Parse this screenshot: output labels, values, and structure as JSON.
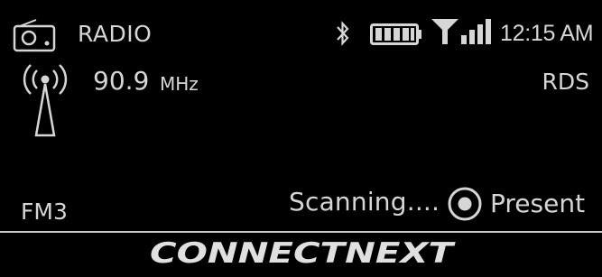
{
  "status_bar": {
    "source": "RADIO",
    "time": "12:15 AM",
    "icons": [
      "radio-icon",
      "bluetooth-icon",
      "battery-icon",
      "signal-icon"
    ]
  },
  "tuner": {
    "frequency": "90.9",
    "unit": "MHz",
    "rds": "RDS",
    "band": "FM3",
    "status": "Scanning....",
    "preset_label": "Present",
    "icons": [
      "antenna-icon",
      "preset-radio-icon"
    ]
  },
  "brand": {
    "logo_text": "CONNECTNEXT"
  },
  "colors": {
    "background": "#000000",
    "text": "#d6d6d6",
    "divider": "#c8c8c8"
  }
}
